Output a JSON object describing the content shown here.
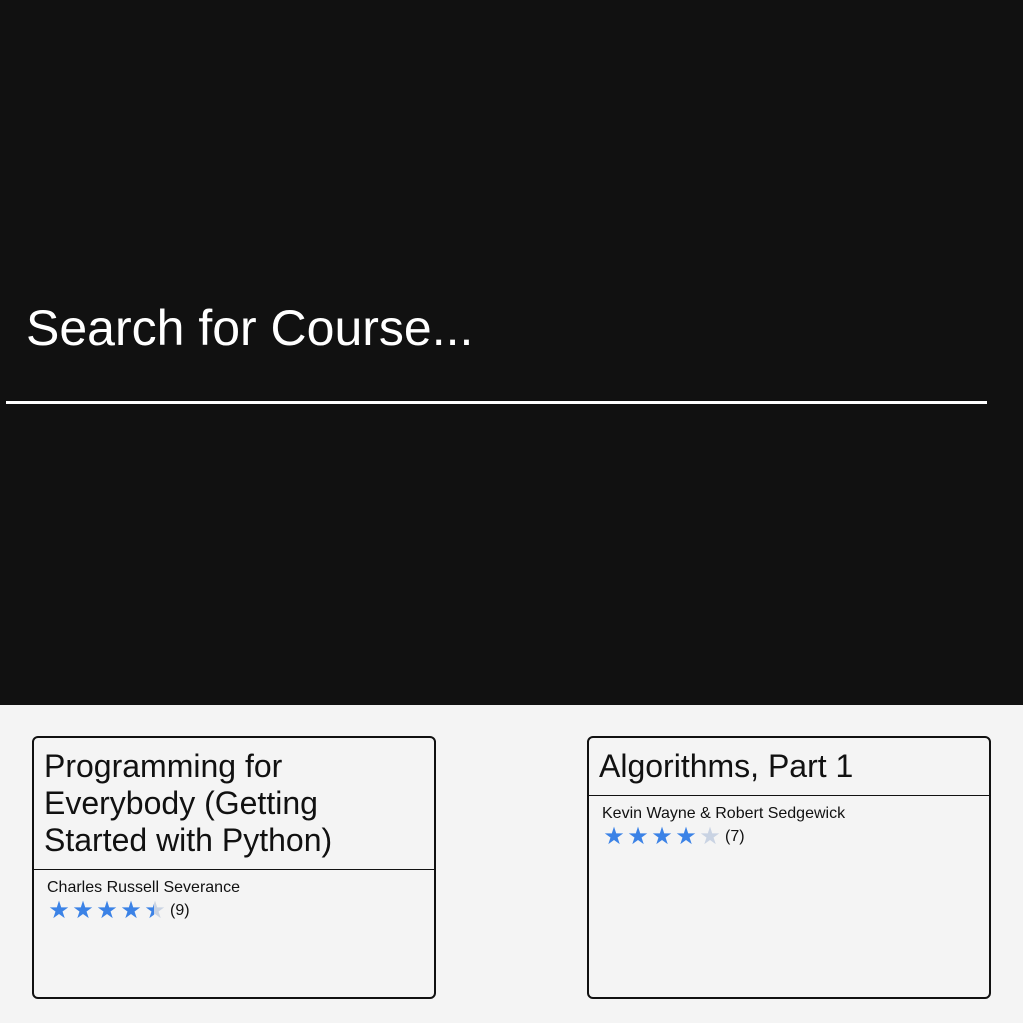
{
  "search": {
    "placeholder": "Search for Course..."
  },
  "colors": {
    "hero_bg": "#111111",
    "accent_star": "#3b82e6",
    "star_empty": "#c9d3e3",
    "results_bg": "#f4f4f4"
  },
  "courses": [
    {
      "title": "Programming for Everybody (Getting Started with Python)",
      "author": "Charles Russell Severance",
      "rating": 4.4,
      "rating_max": 5,
      "rating_count": "(9)"
    },
    {
      "title": "Algorithms, Part 1",
      "author": "Kevin Wayne & Robert Sedgewick",
      "rating": 4.0,
      "rating_max": 5,
      "rating_count": "(7)"
    }
  ]
}
